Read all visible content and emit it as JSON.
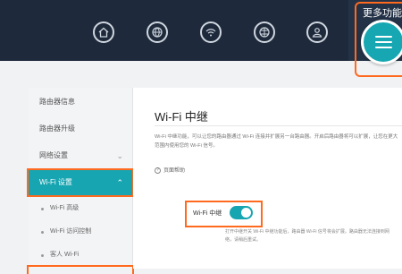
{
  "header": {
    "more_label": "更多功能",
    "nav_icons": [
      "home-icon",
      "globe-icon",
      "wifi-icon",
      "internet-icon",
      "user-icon"
    ],
    "menu_icon": "menu-icon",
    "accent_color": "#17a5b1",
    "highlight_color": "#ff6a1f"
  },
  "sidebar": {
    "items": [
      {
        "label": "路由器信息"
      },
      {
        "label": "路由器升级"
      },
      {
        "label": "网络设置"
      },
      {
        "label": "Wi-Fi 设置"
      }
    ],
    "sub_items": [
      {
        "label": "Wi-Fi 高级"
      },
      {
        "label": "Wi-Fi 访问控制"
      },
      {
        "label": "客人 Wi-Fi"
      }
    ]
  },
  "main": {
    "title": "Wi-Fi 中继",
    "description": "Wi-Fi 中继功能，可以让您的路由器通过 Wi-Fi 连接并扩展另一台路由器。开启后路由器将可以扩展，让您在更大范围内使用您的 Wi-Fi 信号。",
    "help_link": "页面帮助",
    "repeater_label": "Wi-Fi 中继",
    "repeater_enabled": true,
    "repeater_hint": "打开中继开关 Wi-Fi 中继功能后，路由器 Wi-Fi 信号将会扩展。路由器无法连接到网络，请稍后重试。"
  }
}
